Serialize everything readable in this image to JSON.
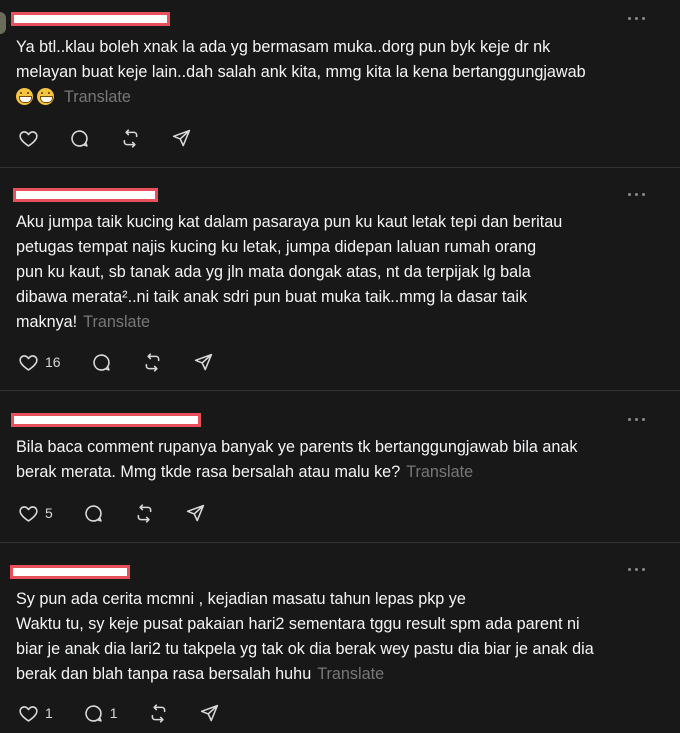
{
  "posts": [
    {
      "text_lines": [
        "Ya btl..klau boleh xnak la ada yg bermasam muka..dorg pun byk keje dr nk",
        "melayan buat keje lain..dah salah ank kita, mmg kita la kena bertanggungjawab"
      ],
      "has_emoji": true,
      "translate": "Translate",
      "likes": "",
      "replies": ""
    },
    {
      "text_lines": [
        "Aku jumpa taik kucing kat dalam pasaraya pun ku kaut letak tepi dan beritau",
        "petugas tempat najis kucing ku letak, jumpa didepan laluan rumah orang",
        "pun ku kaut, sb tanak ada yg jln mata dongak atas, nt da terpijak lg bala",
        "dibawa merata²..ni taik anak sdri pun buat muka taik..mmg la dasar taik",
        "maknya!"
      ],
      "translate": "Translate",
      "likes": "16",
      "replies": ""
    },
    {
      "text_lines": [
        "Bila baca comment rupanya banyak ye parents tk bertanggungjawab bila anak",
        "berak merata. Mmg tkde rasa bersalah atau malu ke?"
      ],
      "translate": "Translate",
      "likes": "5",
      "replies": ""
    },
    {
      "text_lines": [
        "Sy pun ada cerita mcmni , kejadian masatu tahun lepas pkp ye",
        "Waktu tu, sy keje pusat pakaian hari2 sementara tggu result spm ada parent ni",
        "biar je anak dia lari2 tu takpela yg tak ok dia berak wey pastu dia biar je anak dia",
        "berak dan blah tanpa rasa bersalah huhu"
      ],
      "translate": "Translate",
      "likes": "1",
      "replies": "1"
    }
  ],
  "icons": [
    "heart-icon",
    "comment-icon",
    "repost-icon",
    "share-icon",
    "more-icon"
  ],
  "colors": {
    "background": "#181818",
    "text": "#f3f5f7",
    "muted": "#777777",
    "redaction_border": "#e8505b"
  }
}
